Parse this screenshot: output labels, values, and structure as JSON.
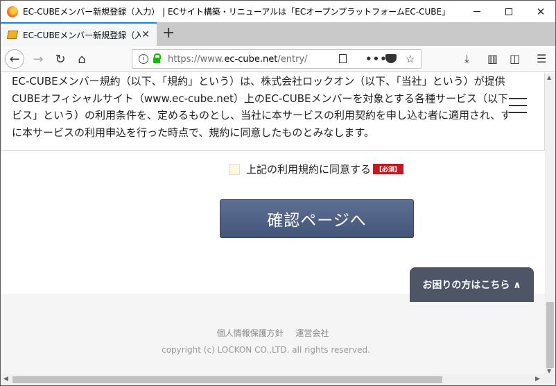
{
  "window": {
    "title": "EC-CUBEメンバー新規登録（入力） | ECサイト構築・リニューアルは「ECオープンプラットフォームEC-CUBE」 - Mozilla Firefox"
  },
  "tab": {
    "label": "EC-CUBEメンバー新規登録（入力"
  },
  "urlbar": {
    "prefix": "https://www.",
    "host": "ec-cube.net",
    "path": "/entry/"
  },
  "terms": {
    "lines": [
      "EC-CUBEメンバー規約（以下、「規約」という）は、株式会社ロックオン（以下、「当社」という）が提供",
      "CUBEオフィシャルサイト（www.ec-cube.net）上のEC-CUBEメンバーを対象とする各種サービス（以下",
      "ビス」という）の利用条件を、定めるものとし、当社に本サービスの利用契約を申し込む者に適用され、す",
      "に本サービスの利用申込を行った時点で、規約に同意したものとみなします。"
    ]
  },
  "agreement": {
    "label": "上記の利用規約に同意する",
    "required_badge": "【必須】"
  },
  "confirm_button": "確認ページへ",
  "footer": {
    "links": [
      "個人情報保護方針",
      "運営会社"
    ],
    "copyright": "copyright (c) LOCKON CO.,LTD. all rights reserved."
  },
  "help_button": "お困りの方はこちら ∧",
  "colors": {
    "confirm_button": "#4f6086",
    "required_badge": "#c9171e",
    "help_button": "#4d5566",
    "tab_accent": "#0a84ff"
  }
}
